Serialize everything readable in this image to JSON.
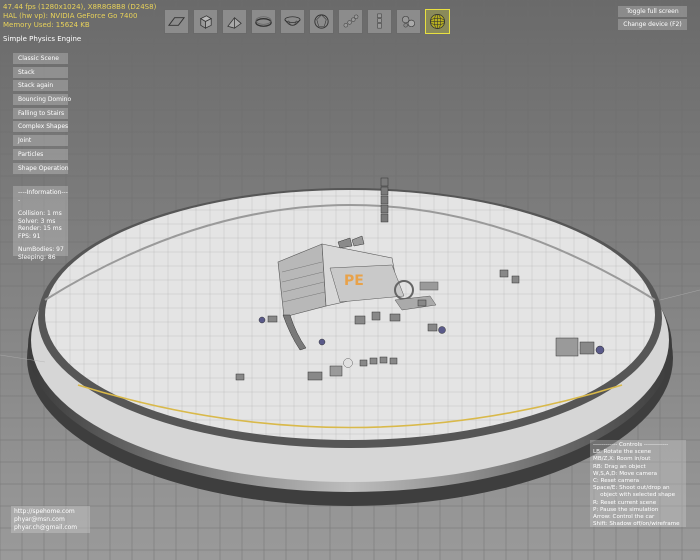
{
  "stats": {
    "line1": "47.44 fps (1280x1024), X8R8G8B8 (D24S8)",
    "line2": "HAL (hw vp): NVIDIA GeForce Go 7400",
    "line3": "Memory Used:    15624  KB"
  },
  "engine_title": "Simple Physics Engine",
  "menu": {
    "items": [
      {
        "label": "Classic Scene"
      },
      {
        "label": "Stack"
      },
      {
        "label": "Stack again"
      },
      {
        "label": "Bouncing Domino"
      },
      {
        "label": "Falling to Stairs"
      },
      {
        "label": "Complex Shapes"
      },
      {
        "label": "Joint"
      },
      {
        "label": "Particles"
      },
      {
        "label": "Shape Operation"
      }
    ]
  },
  "info": {
    "header": "----Information----",
    "collision": "Collision:  1 ms",
    "solver": "Solver:     3 ms",
    "render": "Render:   15 ms",
    "fps": "FPS:   91",
    "num_bodies": "NumBodies:  97",
    "sleeping": "Sleeping:     86"
  },
  "toolbar": {
    "tools": [
      {
        "icon": "plane-icon"
      },
      {
        "icon": "box-icon"
      },
      {
        "icon": "ramp-icon"
      },
      {
        "icon": "ring-icon"
      },
      {
        "icon": "mesh-bowl-icon"
      },
      {
        "icon": "ball-mesh-icon"
      },
      {
        "icon": "chain-icon"
      },
      {
        "icon": "tower-icon"
      },
      {
        "icon": "gear-cluster-icon"
      },
      {
        "icon": "sphere-grid-icon",
        "active": true
      }
    ]
  },
  "buttons": {
    "fullscreen": "Toggle full screen",
    "change_device": "Change device (F2)"
  },
  "controls": {
    "header": "------------ Controls ------------",
    "lines": [
      "LB: Rotate the scene",
      "MB/Z,X: Room in/out",
      "RB: Drag an object",
      "W,S,A,D: Move camera",
      "C: Reset camera",
      "Space/E: Shoot out/drop an",
      "    object with selected shape",
      "R: Reset current scene",
      "P: Pause the simulation",
      "Arrow: Control the car",
      "Shift: Shadow off/on/wireframe"
    ]
  },
  "contacts": {
    "url": "http://spehome.com",
    "email1": "phyar@msn.com",
    "email2": "phyar.ch@gmail.com"
  },
  "scene": {
    "logo_text": "PE"
  },
  "colors": {
    "stats_text": "#e8d25a",
    "active_tool_border": "#e8e040",
    "arena_accent": "#d9b94a"
  }
}
